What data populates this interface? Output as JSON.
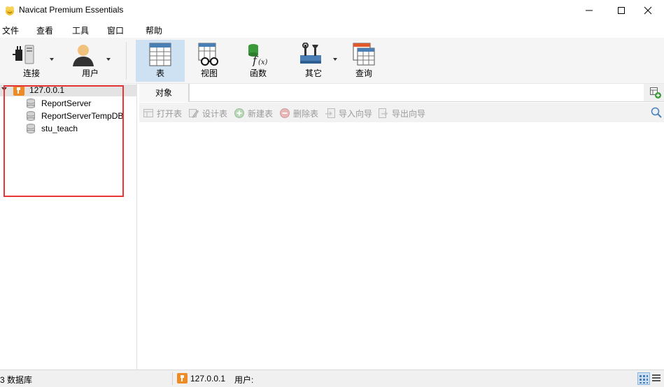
{
  "window": {
    "title": "Navicat Premium Essentials",
    "icon": "navicat-app-icon"
  },
  "menu": {
    "items": [
      "文件",
      "查看",
      "工具",
      "窗口",
      "帮助"
    ]
  },
  "toolbar": {
    "connect_label": "连接",
    "user_label": "用户",
    "table_label": "表",
    "view_label": "视图",
    "function_label": "函数",
    "other_label": "其它",
    "query_label": "查询"
  },
  "tree": {
    "connection": "127.0.0.1",
    "databases": [
      "ReportServer",
      "ReportServerTempDB",
      "stu_teach"
    ]
  },
  "objects": {
    "tab_label": "对象",
    "actions": {
      "open": "打开表",
      "design": "设计表",
      "new": "新建表",
      "delete": "删除表",
      "import": "导入向导",
      "export": "导出向导"
    }
  },
  "status": {
    "db_count": "3 数据库",
    "connection": "127.0.0.1",
    "user": "用户:"
  },
  "colors": {
    "accent_selected": "#cde1f3",
    "connection_orange": "#f08a24",
    "highlight_red": "#e83535"
  }
}
